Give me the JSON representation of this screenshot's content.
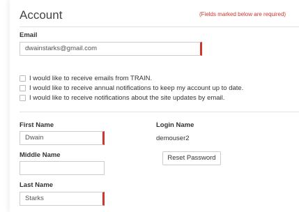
{
  "section": {
    "title": "Account",
    "required_note": "(Fields marked below are required)"
  },
  "email": {
    "label": "Email",
    "value": "dwainstarks@gmail.com"
  },
  "notifications": [
    {
      "label": "I would like to receive emails from TRAIN.",
      "checked": false
    },
    {
      "label": "I would like to receive annual notifications to keep my account up to date.",
      "checked": false
    },
    {
      "label": "I would like to receive notifications about the site updates by email.",
      "checked": false
    }
  ],
  "first_name": {
    "label": "First Name",
    "value": "Dwain"
  },
  "middle_name": {
    "label": "Middle Name",
    "value": ""
  },
  "last_name": {
    "label": "Last Name",
    "value": "Starks"
  },
  "login": {
    "label": "Login Name",
    "value": "demouser2",
    "reset_button": "Reset Password"
  },
  "colors": {
    "required_accent": "#d0352d",
    "border": "#cccccc"
  }
}
